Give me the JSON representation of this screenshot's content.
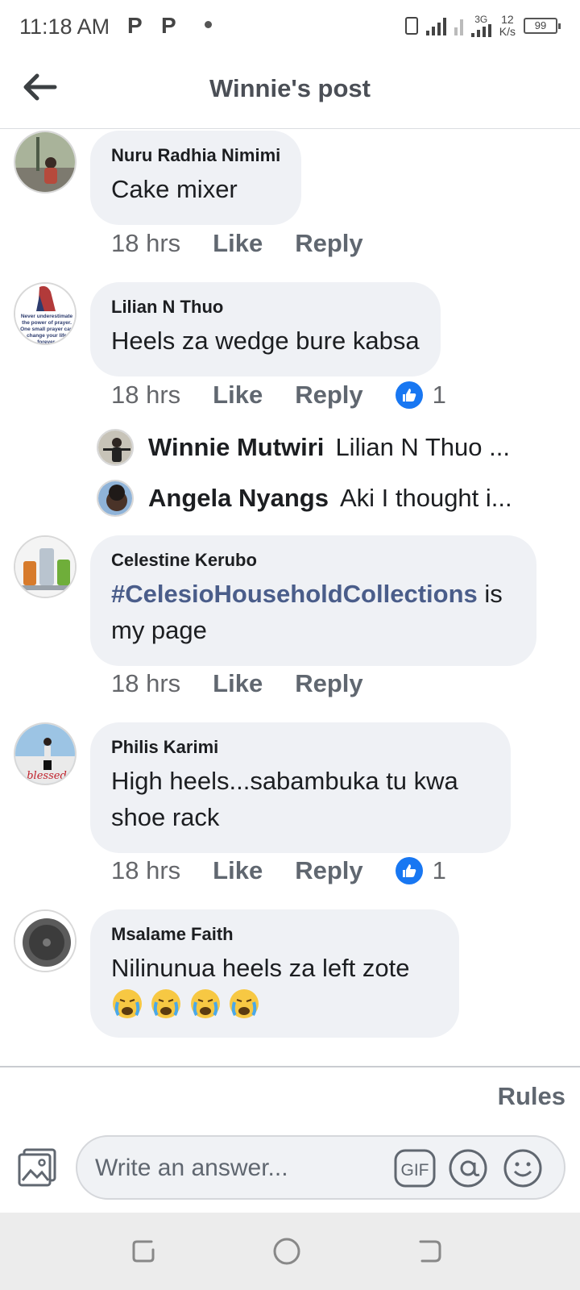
{
  "status": {
    "time": "11:18 AM",
    "notif_p1": "P",
    "notif_p2": "P",
    "net_type": "3G",
    "speed_value": "12",
    "speed_unit": "K/s",
    "battery": "99"
  },
  "header": {
    "title": "Winnie's post"
  },
  "comments": [
    {
      "name": "Nuru Radhia Nimimi",
      "text": "Cake mixer",
      "time": "18 hrs",
      "like": "Like",
      "reply": "Reply"
    },
    {
      "name": "Lilian N Thuo",
      "text": "Heels za wedge bure kabsa",
      "time": "18 hrs",
      "like": "Like",
      "reply": "Reply",
      "reactions": "1"
    },
    {
      "name": "Celestine Kerubo",
      "hashtag": "#CelesioHouseholdCollections",
      "text_after": " is my page",
      "time": "18 hrs",
      "like": "Like",
      "reply": "Reply"
    },
    {
      "name": "Philis Karimi",
      "text": "High heels...sabambuka tu kwa shoe rack",
      "time": "18 hrs",
      "like": "Like",
      "reply": "Reply",
      "reactions": "1"
    },
    {
      "name": "Msalame Faith",
      "text": "Nilinunua heels za left zote"
    }
  ],
  "replies": [
    {
      "name": "Winnie Mutwiri",
      "text": "Lilian N Thuo ..."
    },
    {
      "name": "Angela Nyangs",
      "text": "Aki I thought i..."
    }
  ],
  "avatar_text": {
    "lilian": [
      "Never underestimate",
      "the power of prayer.",
      "One small prayer can",
      "change your life",
      "forever."
    ],
    "philis": "blessed"
  },
  "composer": {
    "rules": "Rules",
    "placeholder": "Write an answer...",
    "gif": "GIF"
  },
  "colors": {
    "like_blue": "#1877f2",
    "hashtag": "#4a5d8a",
    "bubble": "#eff1f5"
  }
}
